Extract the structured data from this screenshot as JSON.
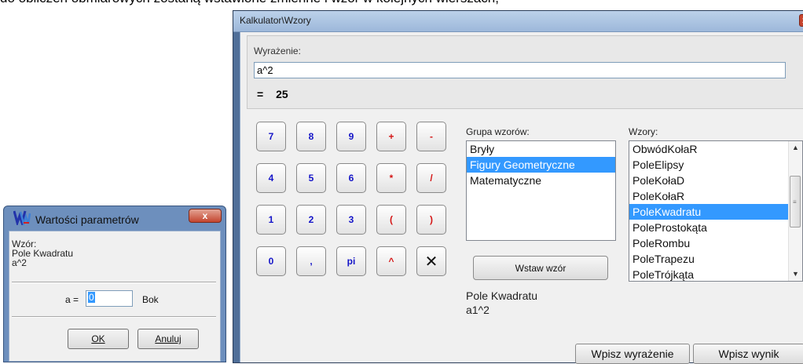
{
  "document": {
    "top_text": "do obliczeń obmiarowych zostaną wstawione zmienne i wzór w kolejnych wierszach,"
  },
  "main_window": {
    "title": "Kalkulator\\Wzory",
    "close_glyph": "x",
    "expression_label": "Wyrażenie:",
    "expression_value": "a^2",
    "result_eq": "=",
    "result_value": "25",
    "keypad": [
      {
        "label": "7",
        "color": "#1414c8"
      },
      {
        "label": "8",
        "color": "#1414c8"
      },
      {
        "label": "9",
        "color": "#1414c8"
      },
      {
        "label": "+",
        "color": "#d41414"
      },
      {
        "label": "-",
        "color": "#d41414"
      },
      {
        "label": "4",
        "color": "#1414c8"
      },
      {
        "label": "5",
        "color": "#1414c8"
      },
      {
        "label": "6",
        "color": "#1414c8"
      },
      {
        "label": "*",
        "color": "#d41414"
      },
      {
        "label": "/",
        "color": "#d41414"
      },
      {
        "label": "1",
        "color": "#1414c8"
      },
      {
        "label": "2",
        "color": "#1414c8"
      },
      {
        "label": "3",
        "color": "#1414c8"
      },
      {
        "label": "(",
        "color": "#d41414"
      },
      {
        "label": ")",
        "color": "#d41414"
      },
      {
        "label": "0",
        "color": "#1414c8"
      },
      {
        "label": ",",
        "color": "#1414c8"
      },
      {
        "label": "pi",
        "color": "#1414c8"
      },
      {
        "label": "^",
        "color": "#d41414"
      },
      {
        "label": "✕",
        "color": "#111111"
      }
    ],
    "group_label": "Grupa wzorów:",
    "groups": [
      "Bryły",
      "Figury Geometryczne",
      "Matematyczne"
    ],
    "groups_selected": "Figury Geometryczne",
    "formulas_label": "Wzory:",
    "formulas": [
      "ObwódKołaR",
      "PoleElipsy",
      "PoleKołaD",
      "PoleKołaR",
      "PoleKwadratu",
      "PoleProstokąta",
      "PoleRombu",
      "PoleTrapezu",
      "PoleTrójkąta"
    ],
    "formulas_selected": "PoleKwadratu",
    "insert_formula_button": "Wstaw wzór",
    "formula_name": "Pole Kwadratu",
    "formula_expression": "a1^2",
    "write_expression_button": "Wpisz wyrażenie",
    "write_result_button": "Wpisz wynik"
  },
  "param_dialog": {
    "title": "Wartości parametrów",
    "close_glyph": "x",
    "formula_caption": "Wzór:",
    "formula_name": "Pole Kwadratu",
    "formula_expression": "a^2",
    "param_label": "a =",
    "param_value": "0",
    "param_unit": "Bok",
    "ok_button": "OK",
    "cancel_button": "Anuluj"
  },
  "colors": {
    "selection": "#3399ff",
    "digit_key": "#1414c8",
    "operator_key": "#d41414",
    "window_frame": "#4f6e98"
  }
}
